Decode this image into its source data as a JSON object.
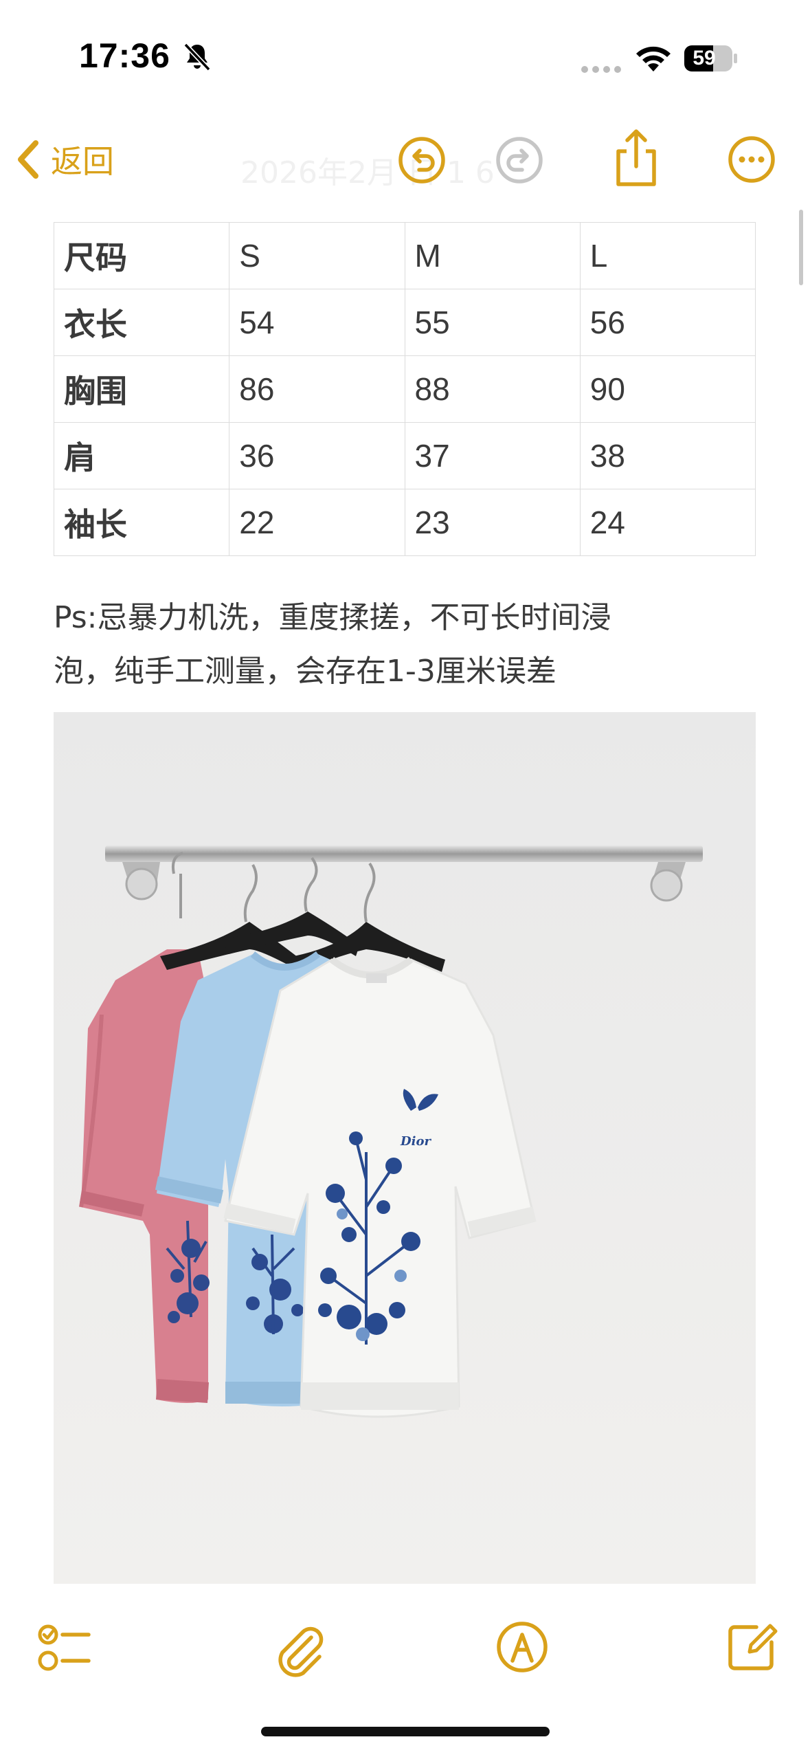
{
  "status_bar": {
    "time": "17:36",
    "battery": "59",
    "icons": [
      "bell-slash-icon",
      "cellular-dots-icon",
      "wifi-icon",
      "battery-icon"
    ]
  },
  "nav": {
    "back_label": "返回",
    "date_faded": "2026年2月 日 1 6",
    "icons": [
      "chevron-left-icon",
      "undo-icon",
      "redo-icon",
      "share-icon",
      "more-icon"
    ]
  },
  "size_table": {
    "header": [
      "尺码",
      "S",
      "M",
      "L"
    ],
    "rows": [
      [
        "衣长",
        "54",
        "55",
        "56"
      ],
      [
        "胸围",
        "86",
        "88",
        "90"
      ],
      [
        "肩",
        "36",
        "37",
        "38"
      ],
      [
        "袖长",
        "22",
        "23",
        "24"
      ]
    ]
  },
  "note": {
    "line1": "Ps:忌暴力机洗，重度揉搓，不可长时间浸",
    "line2": "泡，纯手工测量，会存在1-3厘米误差"
  },
  "photo": {
    "brand_text": "Dior"
  },
  "toolbar": {
    "icons": [
      "checklist-icon",
      "paperclip-icon",
      "markup-pen-icon",
      "compose-icon"
    ]
  },
  "colors": {
    "accent": "#D9A11A",
    "disabled": "#c6c6c6",
    "pink_shirt": "#d8808f",
    "blue_shirt": "#a9cdea",
    "white_shirt": "#f6f6f4"
  }
}
